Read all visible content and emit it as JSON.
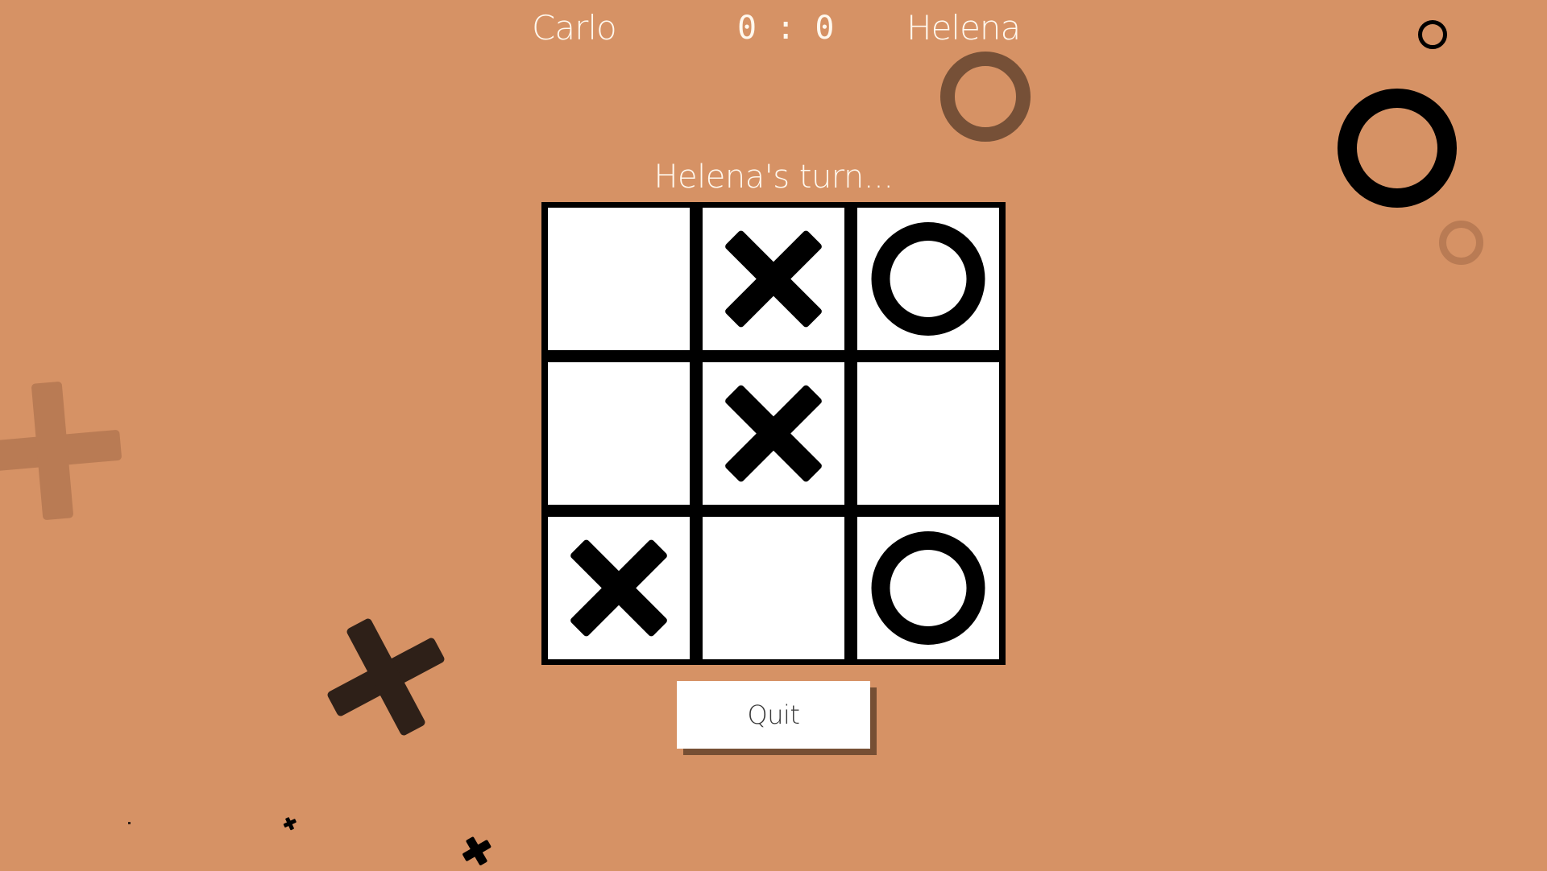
{
  "header": {
    "player1_name": "Carlo",
    "player2_name": "Helena",
    "score": {
      "player1": "0",
      "player2": "0",
      "separator": ":"
    },
    "score_text": "0 : 0"
  },
  "status": {
    "turn_text": "Helena's turn..."
  },
  "board": {
    "rows": 3,
    "cols": 3,
    "cells": [
      "",
      "X",
      "O",
      "",
      "X",
      "",
      "X",
      "",
      "O"
    ]
  },
  "buttons": {
    "quit_label": "Quit"
  },
  "colors": {
    "background": "#d69265",
    "text": "#fff8ee",
    "mark": "#000000",
    "cell": "#ffffff",
    "button_shadow": "#764f34",
    "deco_dark": "#2e2018",
    "deco_brown": "#765037",
    "deco_faded": "#b97b54"
  },
  "decorations": [
    {
      "shape": "ring",
      "color": "deco_brown"
    },
    {
      "shape": "ring",
      "color": "mark"
    },
    {
      "shape": "ring",
      "color": "mark"
    },
    {
      "shape": "ring",
      "color": "deco_faded"
    },
    {
      "shape": "cross",
      "color": "deco_faded"
    },
    {
      "shape": "cross",
      "color": "deco_dark"
    },
    {
      "shape": "cross",
      "color": "mark"
    },
    {
      "shape": "cross",
      "color": "mark"
    },
    {
      "shape": "cross",
      "color": "deco_dark"
    }
  ]
}
